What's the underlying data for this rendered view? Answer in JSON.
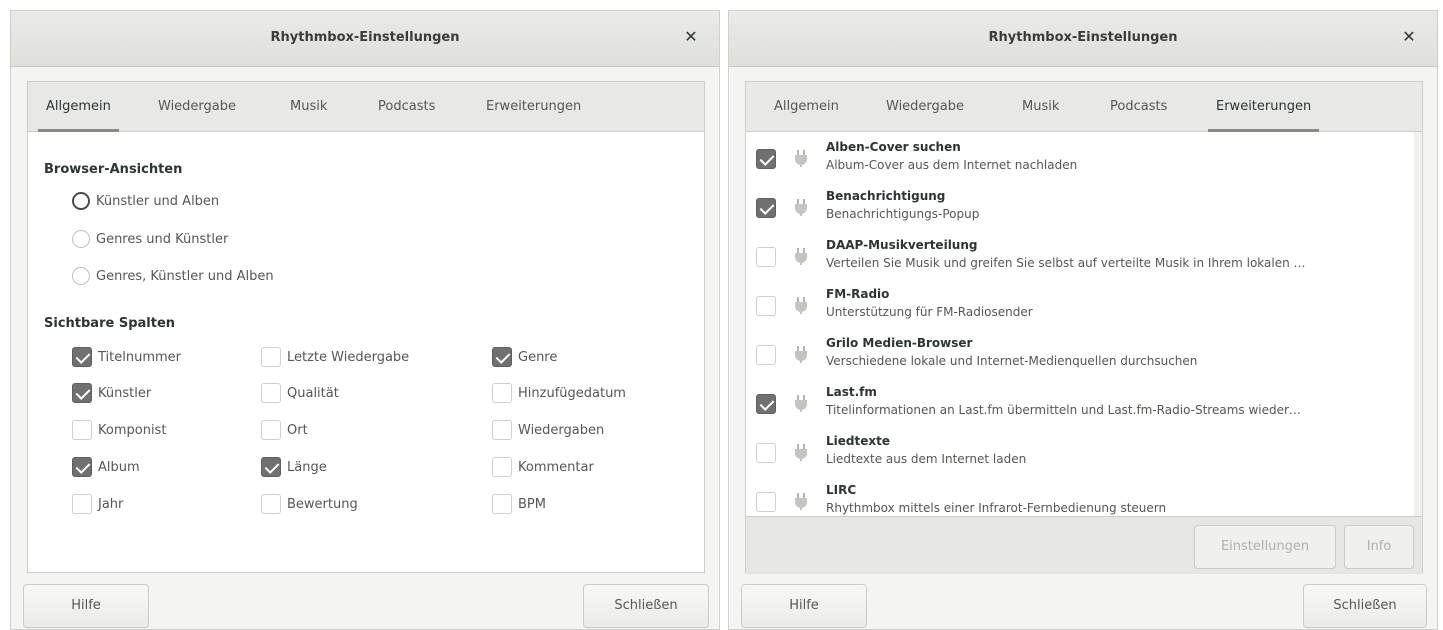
{
  "left_dialog": {
    "title": "Rhythmbox-Einstellungen",
    "close_glyph": "✕",
    "tabs": [
      {
        "label": "Allgemein",
        "active": true
      },
      {
        "label": "Wiedergabe",
        "active": false
      },
      {
        "label": "Musik",
        "active": false
      },
      {
        "label": "Podcasts",
        "active": false
      },
      {
        "label": "Erweiterungen",
        "active": false
      }
    ],
    "browser_views": {
      "title": "Browser-Ansichten",
      "options": [
        {
          "label": "Künstler und Alben",
          "checked": true
        },
        {
          "label": "Genres und Künstler",
          "checked": false
        },
        {
          "label": "Genres, Künstler und Alben",
          "checked": false
        }
      ]
    },
    "visible_columns": {
      "title": "Sichtbare Spalten",
      "columns": [
        [
          {
            "label": "Titelnummer",
            "checked": true
          },
          {
            "label": "Künstler",
            "checked": true
          },
          {
            "label": "Komponist",
            "checked": false
          },
          {
            "label": "Album",
            "checked": true
          },
          {
            "label": "Jahr",
            "checked": false
          }
        ],
        [
          {
            "label": "Letzte Wiedergabe",
            "checked": false
          },
          {
            "label": "Qualität",
            "checked": false
          },
          {
            "label": "Ort",
            "checked": false
          },
          {
            "label": "Länge",
            "checked": true
          },
          {
            "label": "Bewertung",
            "checked": false
          }
        ],
        [
          {
            "label": "Genre",
            "checked": true
          },
          {
            "label": "Hinzufügedatum",
            "checked": false
          },
          {
            "label": "Wiedergaben",
            "checked": false
          },
          {
            "label": "Kommentar",
            "checked": false
          },
          {
            "label": "BPM",
            "checked": false
          }
        ]
      ]
    },
    "help_label": "Hilfe",
    "close_label": "Schließen"
  },
  "right_dialog": {
    "title": "Rhythmbox-Einstellungen",
    "close_glyph": "✕",
    "tabs": [
      {
        "label": "Allgemein",
        "active": false
      },
      {
        "label": "Wiedergabe",
        "active": false
      },
      {
        "label": "Musik",
        "active": false
      },
      {
        "label": "Podcasts",
        "active": false
      },
      {
        "label": "Erweiterungen",
        "active": true
      }
    ],
    "plugins": [
      {
        "name": "Alben-Cover suchen",
        "desc": "Album-Cover aus dem Internet nachladen",
        "checked": true,
        "icon": "plugin-icon"
      },
      {
        "name": "Benachrichtigung",
        "desc": "Benachrichtigungs-Popup",
        "checked": true,
        "icon": "plugin-icon"
      },
      {
        "name": "DAAP-Musikverteilung",
        "desc": "Verteilen Sie Musik und greifen Sie selbst auf verteilte Musik in Ihrem lokalen …",
        "checked": false,
        "icon": "plugin-icon"
      },
      {
        "name": "FM-Radio",
        "desc": "Unterstützung für FM-Radiosender",
        "checked": false,
        "icon": "plugin-icon"
      },
      {
        "name": "Grilo Medien-Browser",
        "desc": "Verschiedene lokale und Internet-Medienquellen durchsuchen",
        "checked": false,
        "icon": "plugin-icon"
      },
      {
        "name": "Last.fm",
        "desc": "Titelinformationen an Last.fm übermitteln und Last.fm-Radio-Streams wieder…",
        "checked": true,
        "icon": "plugin-icon"
      },
      {
        "name": "Liedtexte",
        "desc": "Liedtexte aus dem Internet laden",
        "checked": false,
        "icon": "plugin-icon"
      },
      {
        "name": "LIRC",
        "desc": "Rhythmbox mittels einer Infrarot-Fernbedienung steuern",
        "checked": false,
        "icon": "plugin-icon"
      }
    ],
    "settings_label": "Einstellungen",
    "info_label": "Info",
    "help_label": "Hilfe",
    "close_label": "Schließen"
  }
}
